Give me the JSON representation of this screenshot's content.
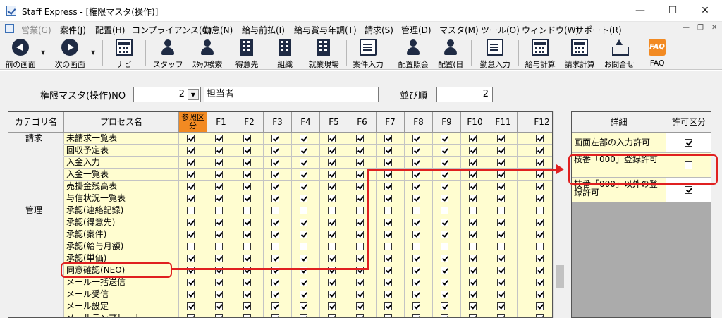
{
  "window": {
    "title": "Staff Express - [権限マスタ(操作)]"
  },
  "menu": [
    {
      "label": "営業(G)",
      "disabled": true
    },
    {
      "label": "案件(J)"
    },
    {
      "label": "配置(H)"
    },
    {
      "label": "コンプライアンス(C)"
    },
    {
      "label": "勤怠(N)"
    },
    {
      "label": "給与前払(I)"
    },
    {
      "label": "給与賞与年調(T)"
    },
    {
      "label": "請求(S)"
    },
    {
      "label": "管理(D)"
    },
    {
      "label": "マスタ(M)"
    },
    {
      "label": "ツール(O)"
    },
    {
      "label": "ウィンドウ(W)"
    },
    {
      "label": "サポート(R)"
    }
  ],
  "toolbar": [
    {
      "label": "前の画面",
      "icon": "back-icon"
    },
    {
      "label": "次の画面",
      "icon": "forward-icon"
    },
    {
      "label": "ナビ",
      "icon": "navi-icon"
    },
    {
      "label": "スタッフ",
      "icon": "staff-icon"
    },
    {
      "label": "ｽﾀｯﾌ検索",
      "icon": "staff-search-icon"
    },
    {
      "label": "得意先",
      "icon": "client-icon"
    },
    {
      "label": "組織",
      "icon": "organization-icon"
    },
    {
      "label": "就業現場",
      "icon": "worksite-icon"
    },
    {
      "label": "案件入力",
      "icon": "job-entry-icon"
    },
    {
      "label": "配置照会",
      "icon": "placement-inquiry-icon"
    },
    {
      "label": "配置(日",
      "icon": "placement-daily-icon"
    },
    {
      "label": "勤怠入力",
      "icon": "attendance-entry-icon"
    },
    {
      "label": "給与計算",
      "icon": "payroll-icon"
    },
    {
      "label": "請求計算",
      "icon": "billing-icon"
    },
    {
      "label": "お問合せ",
      "icon": "inquiry-icon"
    },
    {
      "label": "FAQ",
      "icon": "faq-icon"
    }
  ],
  "form": {
    "no_label": "権限マスタ(操作)NO",
    "no_value": "2",
    "name_value": "担当者",
    "order_label": "並び順",
    "order_value": "2"
  },
  "grid": {
    "headers": [
      "カテゴリ名",
      "プロセス名",
      "参照区分",
      "F1",
      "F2",
      "F3",
      "F4",
      "F5",
      "F6",
      "F7",
      "F8",
      "F9",
      "F10",
      "F11",
      "F12"
    ],
    "rows": [
      {
        "cat": "請求",
        "proc": "未請求一覧表",
        "checks": [
          1,
          1,
          1,
          1,
          1,
          1,
          1,
          1,
          1,
          1,
          1,
          1,
          1
        ]
      },
      {
        "cat": "",
        "proc": "回収予定表",
        "checks": [
          1,
          1,
          1,
          1,
          1,
          1,
          1,
          1,
          1,
          1,
          1,
          1,
          1
        ]
      },
      {
        "cat": "",
        "proc": "入金入力",
        "checks": [
          1,
          1,
          1,
          1,
          1,
          1,
          1,
          1,
          1,
          1,
          1,
          1,
          1
        ]
      },
      {
        "cat": "",
        "proc": "入金一覧表",
        "checks": [
          1,
          1,
          1,
          1,
          1,
          1,
          1,
          1,
          1,
          1,
          1,
          1,
          1
        ]
      },
      {
        "cat": "",
        "proc": "売掛金残高表",
        "checks": [
          1,
          1,
          1,
          1,
          1,
          1,
          1,
          1,
          1,
          1,
          1,
          1,
          1
        ]
      },
      {
        "cat": "",
        "proc": "与信状況一覧表",
        "checks": [
          1,
          1,
          1,
          1,
          1,
          1,
          1,
          1,
          1,
          1,
          1,
          1,
          1
        ]
      },
      {
        "cat": "管理",
        "proc": "承認(連絡記録)",
        "checks": [
          0,
          0,
          0,
          0,
          0,
          0,
          0,
          0,
          0,
          0,
          0,
          0,
          0
        ]
      },
      {
        "cat": "",
        "proc": "承認(得意先)",
        "checks": [
          1,
          1,
          1,
          1,
          1,
          1,
          1,
          1,
          1,
          1,
          1,
          1,
          1
        ]
      },
      {
        "cat": "",
        "proc": "承認(案件)",
        "checks": [
          1,
          1,
          1,
          1,
          1,
          1,
          1,
          1,
          1,
          1,
          1,
          1,
          1
        ]
      },
      {
        "cat": "",
        "proc": "承認(給与月額)",
        "checks": [
          0,
          0,
          0,
          0,
          0,
          0,
          0,
          0,
          0,
          0,
          0,
          0,
          0
        ]
      },
      {
        "cat": "",
        "proc": "承認(単価)",
        "checks": [
          1,
          1,
          1,
          1,
          1,
          1,
          1,
          1,
          1,
          1,
          1,
          1,
          1
        ]
      },
      {
        "cat": "",
        "proc": "同意確認(NEO)",
        "checks": [
          1,
          1,
          1,
          1,
          1,
          1,
          1,
          1,
          1,
          1,
          1,
          1,
          1
        ]
      },
      {
        "cat": "",
        "proc": "メール一括送信",
        "checks": [
          1,
          1,
          1,
          1,
          1,
          1,
          1,
          1,
          1,
          1,
          1,
          1,
          1
        ]
      },
      {
        "cat": "",
        "proc": "メール受信",
        "checks": [
          1,
          1,
          1,
          1,
          1,
          1,
          1,
          1,
          1,
          1,
          1,
          1,
          1
        ]
      },
      {
        "cat": "",
        "proc": "メール設定",
        "checks": [
          1,
          1,
          1,
          1,
          1,
          1,
          1,
          1,
          1,
          1,
          1,
          1,
          1
        ]
      },
      {
        "cat": "",
        "proc": "メールテンプレート",
        "checks": [
          1,
          1,
          1,
          1,
          1,
          1,
          1,
          1,
          1,
          1,
          1,
          1,
          1
        ]
      }
    ]
  },
  "detail": {
    "headers": [
      "詳細",
      "許可区分"
    ],
    "rows": [
      {
        "label": "画面左部の入力許可",
        "checked": true
      },
      {
        "label": "枝番「000」登録許可",
        "checked": false
      },
      {
        "label": "枝番「000」以外の登録許可",
        "checked": true
      }
    ]
  },
  "colors": {
    "highlight": "#e02020",
    "reference": "#f28a22",
    "cell": "#fffdd0"
  }
}
